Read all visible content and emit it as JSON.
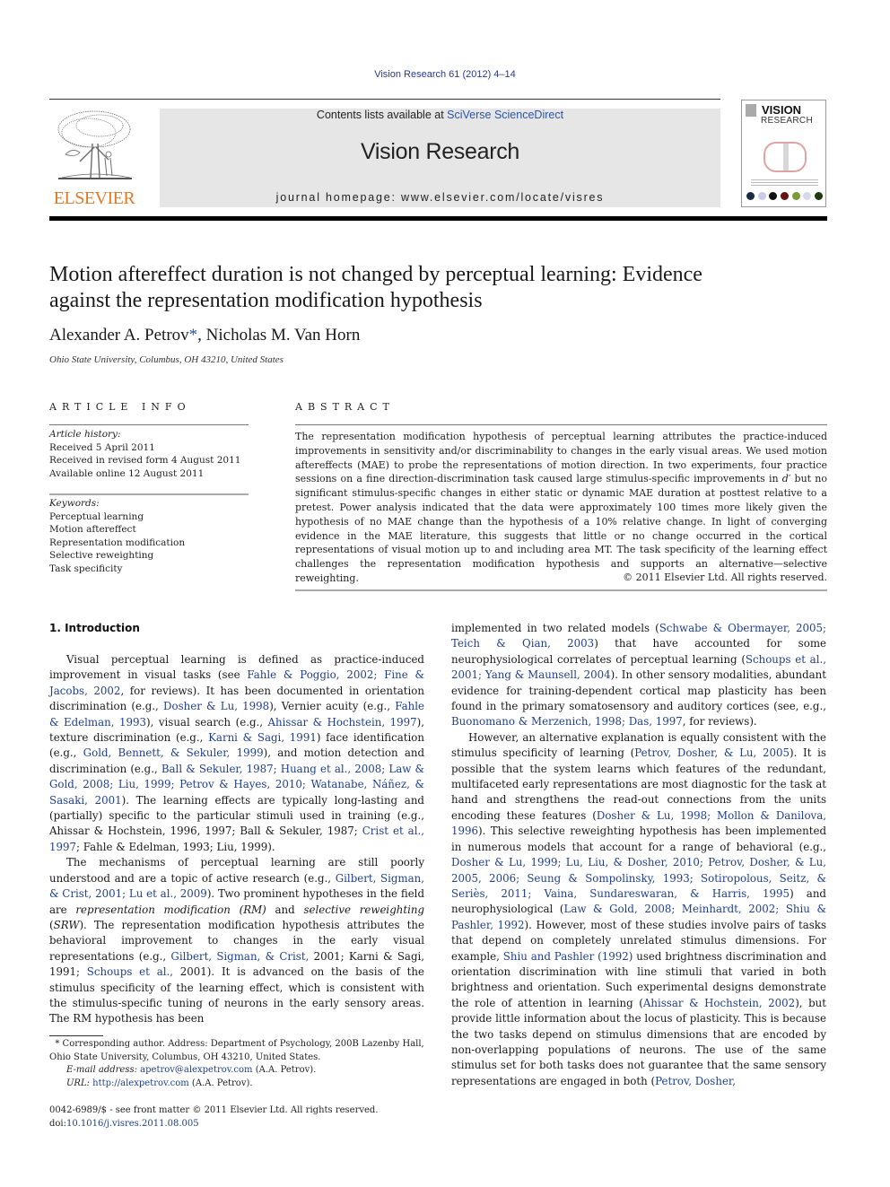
{
  "header": {
    "citation": "Vision Research 61 (2012) 4–14",
    "contents_prefix": "Contents lists available at ",
    "contents_link": "SciVerse ScienceDirect",
    "journal_name": "Vision Research",
    "homepage": "journal homepage: www.elsevier.com/locate/visres",
    "publisher_logo_text": "ELSEVIER",
    "cover": {
      "title_line1": "VISION",
      "title_line2": "RESEARCH",
      "dot_colors": [
        "#1c2a44",
        "#c9c9e8",
        "#111111",
        "#6a1010",
        "#7a9a3a",
        "#d8d8ea",
        "#1f3a10"
      ]
    }
  },
  "article": {
    "title_line1": "Motion aftereffect duration is not changed by perceptual learning: Evidence",
    "title_line2": "against the representation modification hypothesis",
    "authors_part1": "Alexander A. Petrov",
    "author_star": "*",
    "authors_part2": ", Nicholas M. Van Horn",
    "affiliation": "Ohio State University, Columbus, OH 43210, United States"
  },
  "article_info": {
    "heading": "ARTICLE INFO",
    "history_label": "Article history:",
    "history": [
      "Received 5 April 2011",
      "Received in revised form 4 August 2011",
      "Available online 12 August 2011"
    ],
    "keywords_label": "Keywords:",
    "keywords": [
      "Perceptual learning",
      "Motion aftereffect",
      "Representation modification",
      "Selective reweighting",
      "Task specificity"
    ]
  },
  "abstract": {
    "heading": "ABSTRACT",
    "text_part1": "The representation modification hypothesis of perceptual learning attributes the practice-induced improvements in sensitivity and/or discriminability to changes in the early visual areas. We used motion aftereffects (MAE) to probe the representations of motion direction. In two experiments, four practice sessions on a fine direction-discrimination task caused large stimulus-specific improvements in ",
    "text_dprime": "d′",
    "text_part2": " but no significant stimulus-specific changes in either static or dynamic MAE duration at posttest relative to a pretest. Power analysis indicated that the data were approximately 100 times more likely given the hypothesis of no MAE change than the hypothesis of a 10% relative change. In light of converging evidence in the MAE literature, this suggests that little or no change occurred in the cortical representations of visual motion up to and including area MT. The task specificity of the learning effect challenges the representation modification hypothesis and supports an alternative—selective reweighting.",
    "copyright": "© 2011 Elsevier Ltd. All rights reserved."
  },
  "introduction": {
    "heading": "1. Introduction",
    "left": {
      "p1": [
        {
          "t": "Visual perceptual learning is defined as practice-induced improvement in visual tasks (see "
        },
        {
          "l": "Fahle & Poggio, 2002; Fine & Jacobs, 2002"
        },
        {
          "t": ", for reviews). It has been documented in orientation discrimination (e.g., "
        },
        {
          "l": "Dosher & Lu, 1998"
        },
        {
          "t": "), Vernier acuity (e.g., "
        },
        {
          "l": "Fahle & Edelman, 1993"
        },
        {
          "t": "), visual search (e.g., "
        },
        {
          "l": "Ahissar & Hochstein, 1997"
        },
        {
          "t": "), texture discrimination (e.g., "
        },
        {
          "l": "Karni & Sagi, 1991"
        },
        {
          "t": ") face identification (e.g., "
        },
        {
          "l": "Gold, Bennett, & Sekuler, 1999"
        },
        {
          "t": "), and motion detection and discrimination (e.g., "
        },
        {
          "l": "Ball & Sekuler, 1987; Huang et al., 2008; Law & Gold, 2008; Liu, 1999; Petrov & Hayes, 2010; Watanabe, Náñez, & Sasaki, 2001"
        },
        {
          "t": "). The learning effects are typically long-lasting and (partially) specific to the particular stimuli used in training (e.g., Ahissar & Hochstein, 1996, 1997; Ball & Sekuler, 1987; "
        },
        {
          "l": "Crist et al., 1997"
        },
        {
          "t": "; Fahle & Edelman, 1993; Liu, 1999)."
        }
      ],
      "p2": [
        {
          "t": "The mechanisms of perceptual learning are still poorly understood and are a topic of active research (e.g., "
        },
        {
          "l": "Gilbert, Sigman, & Crist, 2001; Lu et al., 2009"
        },
        {
          "t": "). Two prominent hypotheses in the field are "
        },
        {
          "i": "representation modification (RM)"
        },
        {
          "t": " and "
        },
        {
          "i": "selective reweighting"
        },
        {
          "t": " ("
        },
        {
          "i": "SRW"
        },
        {
          "t": "). The representation modification hypothesis attributes the behavioral improvement to changes in the early visual representations (e.g., "
        },
        {
          "l": "Gilbert, Sigman, & Crist,"
        },
        {
          "t": " 2001; Karni & Sagi, 1991; "
        },
        {
          "l": "Schoups et al.,"
        },
        {
          "t": " 2001). It is advanced on the basis of the stimulus specificity of the learning effect, which is consistent with the stimulus-specific tuning of neurons in the early sensory areas. The RM hypothesis has been"
        }
      ]
    },
    "right": {
      "p1": [
        {
          "t": "implemented in two related models ("
        },
        {
          "l": "Schwabe & Obermayer, 2005; Teich & Qian, 2003"
        },
        {
          "t": ") that have accounted for some neurophysiological correlates of perceptual learning ("
        },
        {
          "l": "Schoups et al., 2001; Yang & Maunsell, 2004"
        },
        {
          "t": "). In other sensory modalities, abundant evidence for training-dependent cortical map plasticity has been found in the primary somatosensory and auditory cortices (see, e.g., "
        },
        {
          "l": "Buonomano & Merzenich, 1998; Das, 1997"
        },
        {
          "t": ", for reviews)."
        }
      ],
      "p2": [
        {
          "t": "However, an alternative explanation is equally consistent with the stimulus specificity of learning ("
        },
        {
          "l": "Petrov, Dosher, & Lu, 2005"
        },
        {
          "t": "). It is possible that the system learns which features of the redundant, multifaceted early representations are most diagnostic for the task at hand and strengthens the read-out connections from the units encoding these features ("
        },
        {
          "l": "Dosher & Lu, 1998; Mollon & Danilova, 1996"
        },
        {
          "t": "). This selective reweighting hypothesis has been implemented in numerous models that account for a range of behavioral (e.g., "
        },
        {
          "l": "Dosher & Lu, 1999; Lu, Liu, & Dosher, 2010; Petrov, Dosher, & Lu, 2005, 2006; Seung & Sompolinsky, 1993; Sotiropolous, Seitz, & Seriès, 2011; Vaina, Sundareswaran, & Harris, 1995"
        },
        {
          "t": ") and neurophysiological ("
        },
        {
          "l": "Law & Gold, 2008; Meinhardt, 2002; Shiu & Pashler, 1992"
        },
        {
          "t": "). However, most of these studies involve pairs of tasks that depend on completely unrelated stimulus dimensions. For example, "
        },
        {
          "l": "Shiu and Pashler (1992)"
        },
        {
          "t": " used brightness discrimination and orientation discrimination with line stimuli that varied in both brightness and orientation. Such experimental designs demonstrate the role of attention in learning ("
        },
        {
          "l": "Ahissar & Hochstein, 2002"
        },
        {
          "t": "), but provide little information about the locus of plasticity. This is because the two tasks depend on stimulus dimensions that are encoded by non-overlapping populations of neurons. The use of the same stimulus set for both tasks does not guarantee that the same sensory representations are engaged in both ("
        },
        {
          "l": "Petrov, Dosher,"
        }
      ]
    }
  },
  "footnotes": {
    "star": "*",
    "corresponding": " Corresponding author. Address: Department of Psychology, 200B Lazenby Hall, Ohio State University, Columbus, OH 43210, United States.",
    "email_label": "E-mail address:",
    "email": "apetrov@alexpetrov.com",
    "email_suffix": " (A.A. Petrov).",
    "url_label": "URL:",
    "url": "http://alexpetrov.com",
    "url_suffix": " (A.A. Petrov)."
  },
  "front_matter": {
    "issn_line": "0042-6989/$ - see front matter © 2011 Elsevier Ltd. All rights reserved.",
    "doi_prefix": "doi:",
    "doi": "10.1016/j.visres.2011.08.005"
  }
}
